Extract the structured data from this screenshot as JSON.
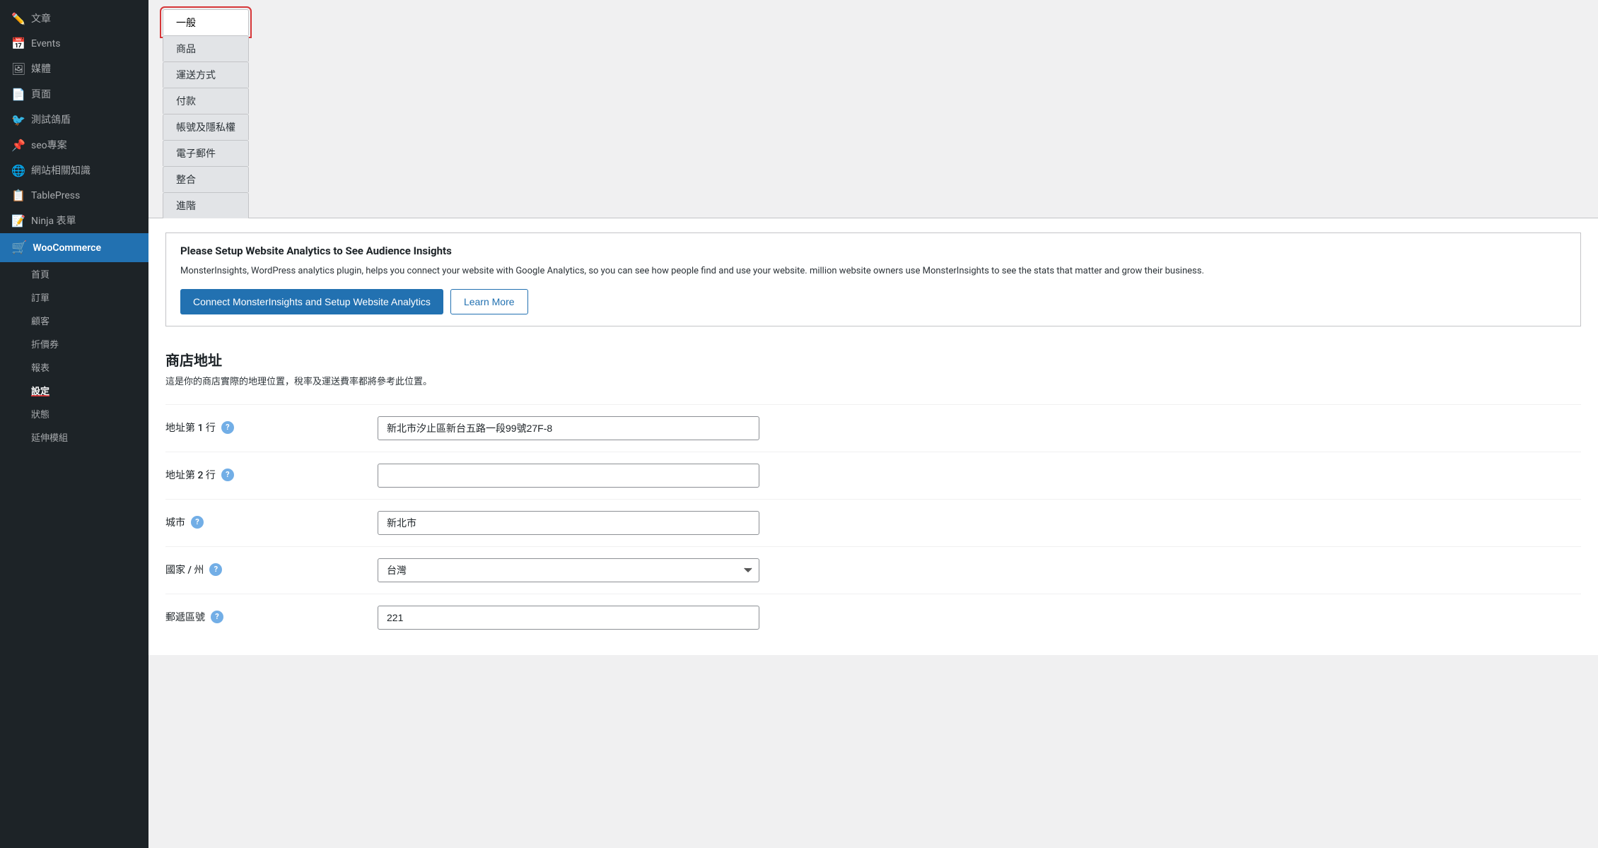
{
  "sidebar": {
    "items": [
      {
        "id": "posts",
        "label": "文章",
        "icon": "✏️"
      },
      {
        "id": "events",
        "label": "Events",
        "icon": "📅"
      },
      {
        "id": "media",
        "label": "媒體",
        "icon": "🖼"
      },
      {
        "id": "pages",
        "label": "頁面",
        "icon": "📄"
      },
      {
        "id": "test-pigeons",
        "label": "測試鴿盾",
        "icon": "🐦"
      },
      {
        "id": "seo",
        "label": "seo專案",
        "icon": "📌"
      },
      {
        "id": "knowledge",
        "label": "網站相關知識",
        "icon": "🌐"
      },
      {
        "id": "tablepress",
        "label": "TablePress",
        "icon": "📋"
      },
      {
        "id": "ninja-forms",
        "label": "Ninja 表單",
        "icon": "📝"
      }
    ],
    "woocommerce_label": "WooCommerce",
    "sub_items": [
      {
        "id": "home",
        "label": "首頁"
      },
      {
        "id": "orders",
        "label": "訂單"
      },
      {
        "id": "customers",
        "label": "顧客"
      },
      {
        "id": "coupons",
        "label": "折價券"
      },
      {
        "id": "reports",
        "label": "報表"
      },
      {
        "id": "settings",
        "label": "設定",
        "active": true
      },
      {
        "id": "status",
        "label": "狀態"
      },
      {
        "id": "extensions",
        "label": "延伸模組"
      }
    ]
  },
  "tabs": [
    {
      "id": "general",
      "label": "一般",
      "active": true
    },
    {
      "id": "products",
      "label": "商品"
    },
    {
      "id": "shipping",
      "label": "運送方式"
    },
    {
      "id": "payments",
      "label": "付款"
    },
    {
      "id": "accounts",
      "label": "帳號及隱私權"
    },
    {
      "id": "email",
      "label": "電子郵件"
    },
    {
      "id": "integration",
      "label": "整合"
    },
    {
      "id": "advanced",
      "label": "進階"
    }
  ],
  "banner": {
    "title": "Please Setup Website Analytics to See Audience Insights",
    "description": "MonsterInsights, WordPress analytics plugin, helps you connect your website with Google Analytics, so you can see how people find and use your website. million website owners use MonsterInsights to see the stats that matter and grow their business.",
    "connect_button": "Connect MonsterInsights and Setup Website Analytics",
    "learn_more_button": "Learn More"
  },
  "store_address": {
    "section_title": "商店地址",
    "section_desc": "這是你的商店實際的地理位置，稅率及運送費率都將參考此位置。",
    "fields": [
      {
        "id": "address1",
        "label": "地址第 1 行",
        "value": "新北市汐止區新台五路一段99號27F-8",
        "placeholder": "",
        "type": "text"
      },
      {
        "id": "address2",
        "label": "地址第 2 行",
        "value": "",
        "placeholder": "",
        "type": "text"
      },
      {
        "id": "city",
        "label": "城市",
        "value": "新北市",
        "placeholder": "",
        "type": "text"
      },
      {
        "id": "country",
        "label": "國家 / 州",
        "value": "台灣",
        "type": "select",
        "options": [
          "台灣"
        ]
      },
      {
        "id": "postcode",
        "label": "郵遞區號",
        "value": "221",
        "placeholder": "",
        "type": "text"
      }
    ]
  }
}
